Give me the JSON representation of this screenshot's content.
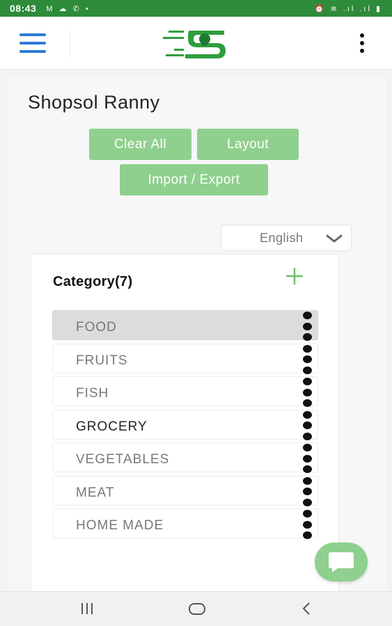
{
  "status_bar": {
    "time": "08:43",
    "left_icons": "M ☁ ✆ •",
    "right_icons": "⏰ ≋ .ıl .ıl ▮"
  },
  "app_bar": {
    "menu_icon": "hamburger-icon",
    "logo": "shopsol-logo",
    "more_icon": "kebab-icon"
  },
  "page": {
    "title": "Shopsol Ranny",
    "buttons": {
      "clear_all": "Clear All",
      "layout": "Layout",
      "import_export": "Import / Export"
    },
    "language": "English"
  },
  "category": {
    "heading": "Category(7)",
    "items": [
      {
        "label": "FOOD"
      },
      {
        "label": "FRUITS"
      },
      {
        "label": "FISH"
      },
      {
        "label": "GROCERY"
      },
      {
        "label": "VEGETABLES"
      },
      {
        "label": "MEAT"
      },
      {
        "label": "HOME MADE"
      }
    ]
  },
  "colors": {
    "accent": "#8fd08e",
    "status": "#2e8b3a",
    "menu": "#2a7bd6"
  }
}
